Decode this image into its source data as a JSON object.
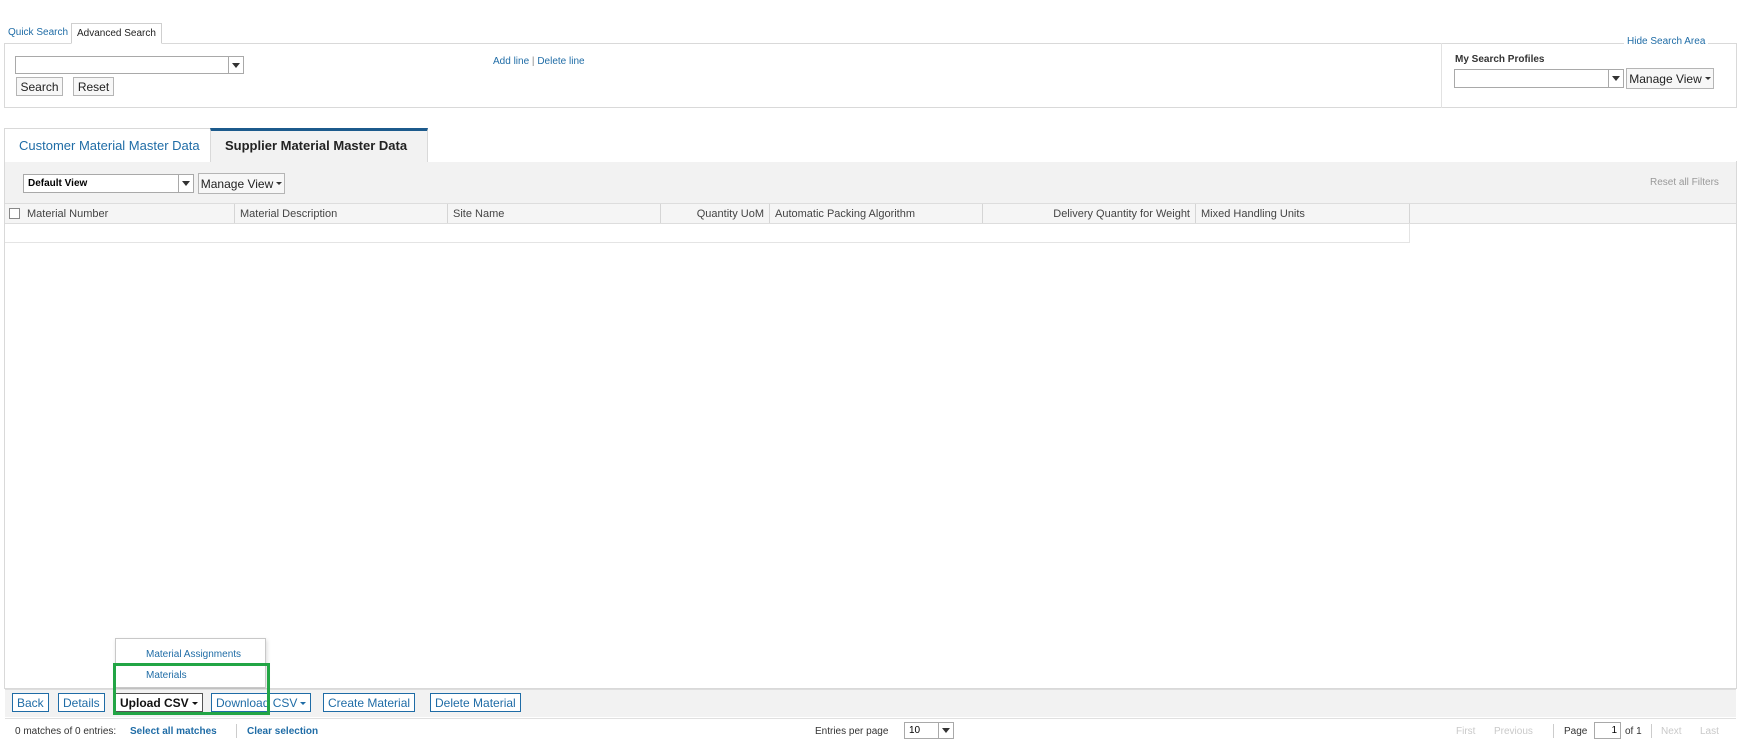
{
  "search_modes": {
    "quick": "Quick Search",
    "advanced": "Advanced Search"
  },
  "search_area": {
    "hide_label": "Hide Search Area",
    "field_select_value": "",
    "search_button": "Search",
    "reset_button": "Reset",
    "add_line": "Add line",
    "separator": "|",
    "delete_line": "Delete line",
    "profiles_label": "My Search Profiles",
    "profile_select_value": "",
    "manage_view": "Manage View"
  },
  "tabs": [
    {
      "label": "Customer Material Master Data",
      "active": false
    },
    {
      "label": "Supplier Material Master Data",
      "active": true
    }
  ],
  "view_bar": {
    "view_select": "Default View",
    "manage_view": "Manage View",
    "reset_filters": "Reset all Filters"
  },
  "table": {
    "columns": [
      "Material Number",
      "Material Description",
      "Site Name",
      "Quantity UoM",
      "Automatic Packing Algorithm",
      "Delivery Quantity for Weight",
      "Mixed Handling Units"
    ],
    "rows": []
  },
  "upload_menu": {
    "items": [
      "Material Assignments",
      "Materials"
    ]
  },
  "actions": {
    "back": "Back",
    "details": "Details",
    "upload_csv": "Upload CSV",
    "download_csv": "Download CSV",
    "create_material": "Create Material",
    "delete_material": "Delete Material"
  },
  "footer": {
    "matches": "0 matches of 0 entries:",
    "select_all": "Select all matches",
    "clear_selection": "Clear selection",
    "entries_label": "Entries per page",
    "entries_value": "10",
    "first": "First",
    "previous": "Previous",
    "page_label": "Page",
    "page_value": "1",
    "of_total": "of 1",
    "next": "Next",
    "last": "Last"
  },
  "colors": {
    "link": "#1f6ca6",
    "active_tab_border": "#1c5a8c",
    "highlight": "#22a545"
  }
}
